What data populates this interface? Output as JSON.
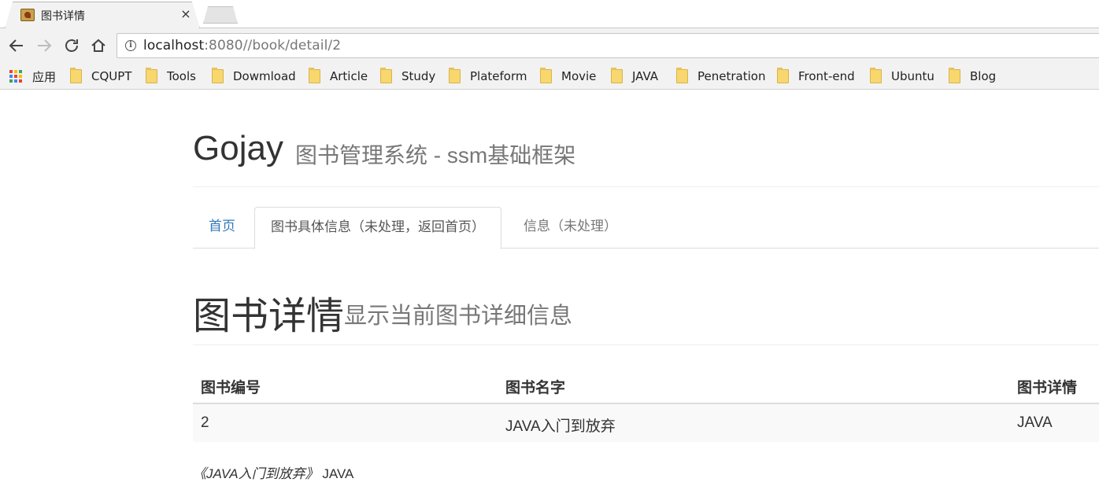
{
  "browser": {
    "tab_title": "图书详情",
    "close_glyph": "×",
    "url_host": "localhost",
    "url_rest": ":8080//book/detail/2",
    "bookmarks": [
      {
        "label": "应用",
        "icon": "apps-icon"
      },
      {
        "label": "CQUPT",
        "icon": "folder-icon"
      },
      {
        "label": "Tools",
        "icon": "folder-icon"
      },
      {
        "label": "Dowmload",
        "icon": "folder-icon"
      },
      {
        "label": "Article",
        "icon": "folder-icon"
      },
      {
        "label": "Study",
        "icon": "folder-icon"
      },
      {
        "label": "Plateform",
        "icon": "folder-icon"
      },
      {
        "label": "Movie",
        "icon": "folder-icon"
      },
      {
        "label": "JAVA",
        "icon": "folder-icon"
      },
      {
        "label": "Penetration",
        "icon": "folder-icon"
      },
      {
        "label": "Front-end",
        "icon": "folder-icon"
      },
      {
        "label": "Ubuntu",
        "icon": "folder-icon"
      },
      {
        "label": "Blog",
        "icon": "folder-icon"
      }
    ]
  },
  "header": {
    "brand": "Gojay",
    "subtitle": "图书管理系统 - ssm基础框架"
  },
  "nav": {
    "tabs": [
      {
        "label": "首页",
        "state": "link"
      },
      {
        "label": "图书具体信息（未处理，返回首页）",
        "state": "active"
      },
      {
        "label": "信息（未处理）",
        "state": "muted"
      }
    ]
  },
  "section": {
    "title": "图书详情",
    "subtitle": "显示当前图书详细信息"
  },
  "table": {
    "columns": [
      "图书编号",
      "图书名字",
      "图书详情"
    ],
    "rows": [
      [
        "2",
        "JAVA入门到放弃",
        "JAVA"
      ]
    ]
  },
  "footnote": {
    "book_title": "《JAVA入门到放弃》",
    "detail": "JAVA"
  },
  "colors": {
    "link": "#337ab7",
    "muted_text": "#777777",
    "border": "#dddddd",
    "row_stripe": "#f9f9f9"
  }
}
